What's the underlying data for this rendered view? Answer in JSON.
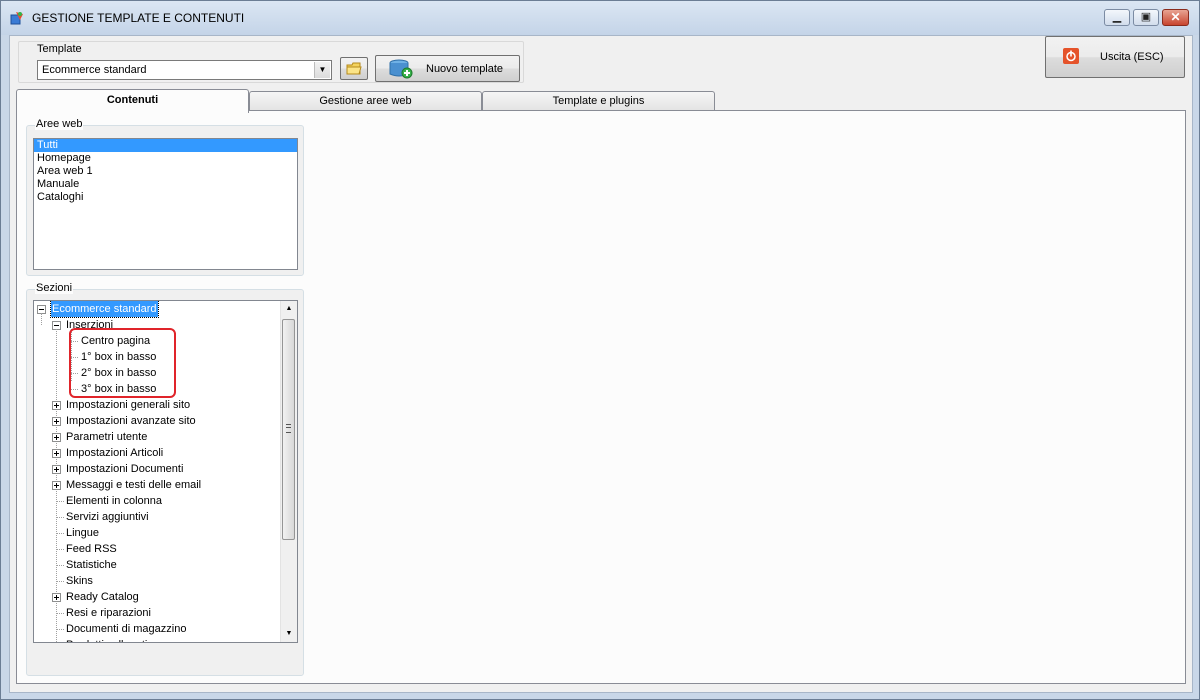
{
  "window": {
    "title": "GESTIONE TEMPLATE E CONTENUTI",
    "icon": "template-app-icon",
    "controls": [
      "minimize-icon",
      "maximize-icon",
      "close-icon"
    ]
  },
  "template_group": {
    "label": "Template",
    "selected": "Ecommerce standard",
    "folder_icon": "folder-icon",
    "new_button_label": "Nuovo template",
    "new_button_icon": "add-database-icon"
  },
  "exit_button": {
    "label": "Uscita (ESC)",
    "icon": "power-icon"
  },
  "tabs": [
    {
      "label": "Contenuti",
      "active": true
    },
    {
      "label": "Gestione aree web",
      "active": false
    },
    {
      "label": "Template e plugins",
      "active": false
    }
  ],
  "aree_web": {
    "caption": "Aree web",
    "items": [
      "Tutti",
      "Homepage",
      "Area web 1",
      "Manuale",
      "Cataloghi"
    ],
    "selected_index": 0
  },
  "sezioni": {
    "caption": "Sezioni",
    "root": "Ecommerce standard",
    "inserzioni": {
      "label": "Inserzioni",
      "children": [
        "Centro pagina",
        "1° box in basso",
        "2° box in basso",
        "3° box in basso"
      ]
    },
    "items": [
      {
        "label": "Impostazioni generali sito",
        "expandable": true
      },
      {
        "label": "Impostazioni avanzate sito",
        "expandable": true
      },
      {
        "label": "Parametri utente",
        "expandable": true
      },
      {
        "label": "Impostazioni Articoli",
        "expandable": true
      },
      {
        "label": "Impostazioni Documenti",
        "expandable": true
      },
      {
        "label": "Messaggi e testi delle email",
        "expandable": true
      },
      {
        "label": "Elementi in colonna",
        "expandable": false
      },
      {
        "label": "Servizi aggiuntivi",
        "expandable": false
      },
      {
        "label": "Lingue",
        "expandable": false
      },
      {
        "label": "Feed RSS",
        "expandable": false
      },
      {
        "label": "Statistiche",
        "expandable": false
      },
      {
        "label": "Skins",
        "expandable": false
      },
      {
        "label": "Ready Catalog",
        "expandable": true
      },
      {
        "label": "Resi e riparazioni",
        "expandable": false
      },
      {
        "label": "Documenti di magazzino",
        "expandable": false
      },
      {
        "label": "Prodotti collegati",
        "expandable": false
      }
    ]
  },
  "colors": {
    "selection": "#3399ff",
    "highlight": "#e0242a",
    "close_button": "#c8452f"
  }
}
